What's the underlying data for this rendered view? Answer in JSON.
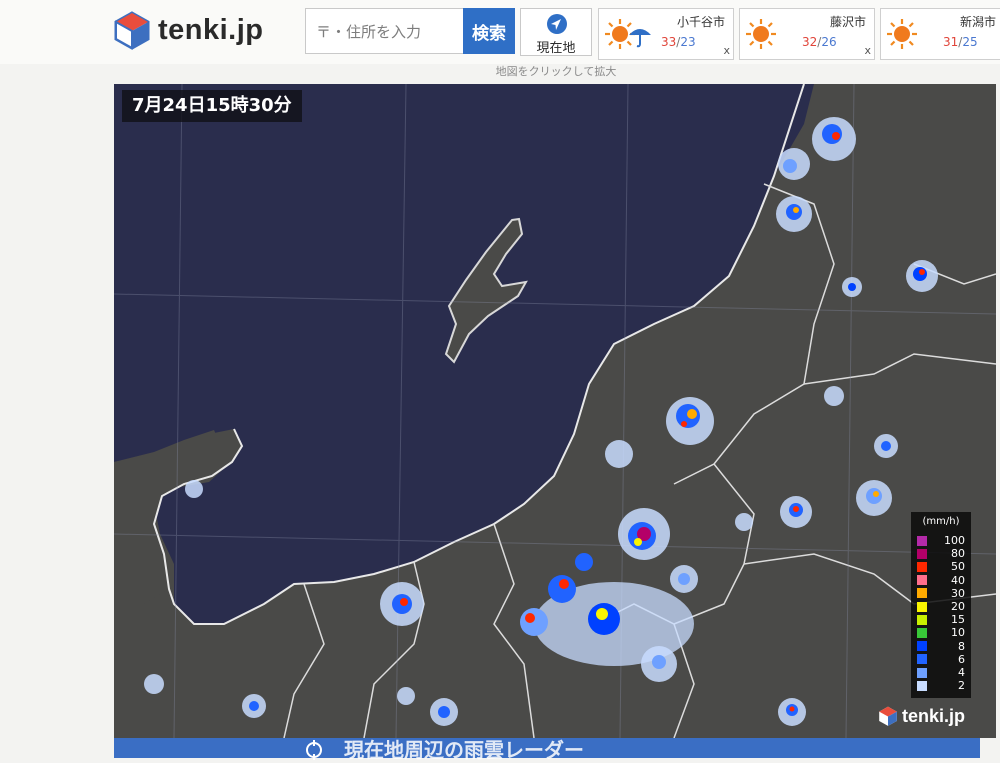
{
  "header": {
    "logo_text": "tenki.jp",
    "search_placeholder": "〒・住所を入力",
    "search_button": "検索",
    "location_button": "現在地",
    "cities": [
      {
        "name": "小千谷市",
        "high": "33",
        "low": "23",
        "close": "x",
        "weather": "sunny-then-rain"
      },
      {
        "name": "藤沢市",
        "high": "32",
        "low": "26",
        "close": "x",
        "weather": "sunny"
      },
      {
        "name": "新潟市",
        "high": "31",
        "low": "25",
        "close": "x",
        "weather": "sunny"
      }
    ]
  },
  "map": {
    "hint": "地図をクリックして拡大",
    "timestamp": "7月24日15時30分",
    "legend": {
      "unit": "(mm/h)",
      "levels": [
        {
          "label": "100",
          "color": "#b42aa8"
        },
        {
          "label": "80",
          "color": "#b40068"
        },
        {
          "label": "50",
          "color": "#ff2800"
        },
        {
          "label": "40",
          "color": "#ff6e8c"
        },
        {
          "label": "30",
          "color": "#ffaa00"
        },
        {
          "label": "20",
          "color": "#faf500"
        },
        {
          "label": "15",
          "color": "#c8f000"
        },
        {
          "label": "10",
          "color": "#38c838"
        },
        {
          "label": "8",
          "color": "#0041ff"
        },
        {
          "label": "6",
          "color": "#2163ff"
        },
        {
          "label": "4",
          "color": "#6ea0ff"
        },
        {
          "label": "2",
          "color": "#c8dcff"
        }
      ]
    },
    "watermark": "tenki.jp"
  },
  "banner": {
    "text": "現在地周辺の雨雲レーダー"
  }
}
